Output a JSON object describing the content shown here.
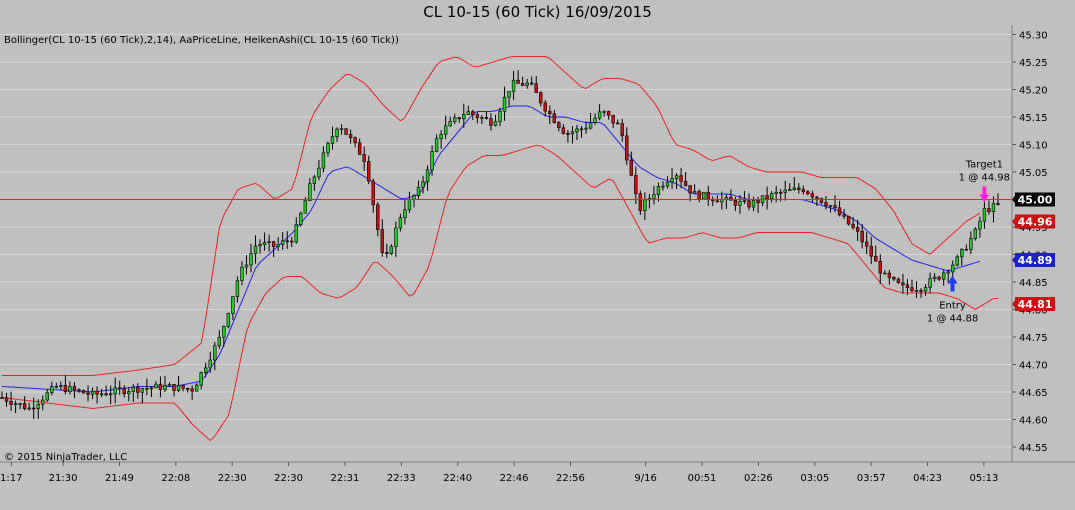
{
  "header": {
    "title": "CL 10-15 (60 Tick)  16/09/2015"
  },
  "indicators_label": "Bollinger(CL 10-15 (60 Tick),2,14), AaPriceLine, HeikenAshi(CL 10-15 (60 Tick))",
  "copyright": "© 2015 NinjaTrader, LLC",
  "colors": {
    "background": "#c0c0c0",
    "grid": "#d6d6d6",
    "up_candle": "#22cc22",
    "down_candle": "#cc1111",
    "bollinger": "#ee2222",
    "middle_band": "#2222ee",
    "price_line": "#ee2222",
    "entry_arrow": "#1f3fff",
    "target_arrow": "#ff22dd"
  },
  "chart_data": {
    "type": "candlestick",
    "ylim": [
      44.53,
      45.31
    ],
    "y_ticks": [
      "45.30",
      "45.25",
      "45.20",
      "45.15",
      "45.10",
      "45.05",
      "45.00",
      "44.95",
      "44.90",
      "44.85",
      "44.80",
      "44.75",
      "44.70",
      "44.65",
      "44.60",
      "44.55"
    ],
    "x_ticks": [
      "1:17",
      "21:30",
      "21:49",
      "22:08",
      "22:30",
      "22:30",
      "22:31",
      "22:33",
      "22:40",
      "22:46",
      "22:56",
      "9/16",
      "00:51",
      "02:26",
      "03:05",
      "03:57",
      "04:23",
      "05:13"
    ],
    "x_tick_positions": [
      2,
      13,
      25,
      37,
      49,
      61,
      73,
      85,
      97,
      109,
      121,
      137,
      149,
      161,
      173,
      185,
      197,
      209
    ],
    "bar_count": 221,
    "price_tags": [
      {
        "name": "current-price",
        "label": "45.00",
        "value": 45.0,
        "bg": "#000000"
      },
      {
        "name": "upper-band",
        "label": "44.96",
        "value": 44.96,
        "bg": "#cc1111"
      },
      {
        "name": "middle-band",
        "label": "44.89",
        "value": 44.89,
        "bg": "#1a22cc"
      },
      {
        "name": "lower-band",
        "label": "44.81",
        "value": 44.81,
        "bg": "#cc1111"
      }
    ],
    "price_line": 45.0,
    "price_path": [
      [
        0,
        44.64
      ],
      [
        6,
        44.62
      ],
      [
        12,
        44.66
      ],
      [
        20,
        44.645
      ],
      [
        28,
        44.655
      ],
      [
        36,
        44.66
      ],
      [
        42,
        44.655
      ],
      [
        48,
        44.75
      ],
      [
        52,
        44.86
      ],
      [
        56,
        44.92
      ],
      [
        60,
        44.915
      ],
      [
        64,
        44.93
      ],
      [
        68,
        45.03
      ],
      [
        74,
        45.14
      ],
      [
        80,
        45.07
      ],
      [
        84,
        44.88
      ],
      [
        88,
        44.98
      ],
      [
        92,
        45.02
      ],
      [
        96,
        45.12
      ],
      [
        102,
        45.16
      ],
      [
        108,
        45.14
      ],
      [
        112,
        45.21
      ],
      [
        116,
        45.21
      ],
      [
        120,
        45.16
      ],
      [
        124,
        45.12
      ],
      [
        128,
        45.13
      ],
      [
        132,
        45.16
      ],
      [
        136,
        45.13
      ],
      [
        140,
        44.98
      ],
      [
        144,
        45.02
      ],
      [
        148,
        45.05
      ],
      [
        152,
        45.01
      ],
      [
        158,
        45.0
      ],
      [
        164,
        44.99
      ],
      [
        170,
        45.01
      ],
      [
        176,
        45.02
      ],
      [
        182,
        44.99
      ],
      [
        188,
        44.94
      ],
      [
        194,
        44.86
      ],
      [
        198,
        44.84
      ],
      [
        202,
        44.84
      ],
      [
        206,
        44.86
      ],
      [
        210,
        44.89
      ],
      [
        214,
        44.94
      ],
      [
        216,
        44.98
      ],
      [
        219,
        44.99
      ]
    ],
    "bollinger_upper": [
      [
        0,
        44.68
      ],
      [
        20,
        44.68
      ],
      [
        30,
        44.69
      ],
      [
        38,
        44.7
      ],
      [
        44,
        44.74
      ],
      [
        48,
        44.96
      ],
      [
        52,
        45.02
      ],
      [
        56,
        45.03
      ],
      [
        60,
        45.0
      ],
      [
        64,
        45.02
      ],
      [
        68,
        45.15
      ],
      [
        72,
        45.2
      ],
      [
        76,
        45.23
      ],
      [
        80,
        45.21
      ],
      [
        84,
        45.17
      ],
      [
        88,
        45.14
      ],
      [
        92,
        45.2
      ],
      [
        96,
        45.25
      ],
      [
        100,
        45.26
      ],
      [
        104,
        45.24
      ],
      [
        108,
        45.25
      ],
      [
        112,
        45.26
      ],
      [
        116,
        45.26
      ],
      [
        120,
        45.26
      ],
      [
        124,
        45.23
      ],
      [
        128,
        45.2
      ],
      [
        132,
        45.22
      ],
      [
        136,
        45.22
      ],
      [
        140,
        45.21
      ],
      [
        144,
        45.17
      ],
      [
        148,
        45.1
      ],
      [
        152,
        45.09
      ],
      [
        156,
        45.07
      ],
      [
        160,
        45.08
      ],
      [
        164,
        45.06
      ],
      [
        168,
        45.05
      ],
      [
        172,
        45.05
      ],
      [
        176,
        45.05
      ],
      [
        180,
        45.04
      ],
      [
        184,
        45.04
      ],
      [
        188,
        45.04
      ],
      [
        192,
        45.02
      ],
      [
        196,
        44.98
      ],
      [
        200,
        44.92
      ],
      [
        204,
        44.9
      ],
      [
        208,
        44.93
      ],
      [
        212,
        44.96
      ],
      [
        216,
        44.98
      ]
    ],
    "bollinger_lower": [
      [
        0,
        44.64
      ],
      [
        20,
        44.62
      ],
      [
        30,
        44.63
      ],
      [
        38,
        44.63
      ],
      [
        42,
        44.59
      ],
      [
        46,
        44.56
      ],
      [
        50,
        44.61
      ],
      [
        54,
        44.77
      ],
      [
        58,
        44.83
      ],
      [
        62,
        44.86
      ],
      [
        66,
        44.86
      ],
      [
        70,
        44.83
      ],
      [
        74,
        44.82
      ],
      [
        78,
        44.84
      ],
      [
        82,
        44.89
      ],
      [
        86,
        44.86
      ],
      [
        90,
        44.82
      ],
      [
        94,
        44.88
      ],
      [
        98,
        45.01
      ],
      [
        102,
        45.06
      ],
      [
        106,
        45.08
      ],
      [
        110,
        45.08
      ],
      [
        114,
        45.09
      ],
      [
        118,
        45.1
      ],
      [
        122,
        45.08
      ],
      [
        126,
        45.05
      ],
      [
        130,
        45.02
      ],
      [
        134,
        45.04
      ],
      [
        138,
        44.98
      ],
      [
        142,
        44.92
      ],
      [
        146,
        44.93
      ],
      [
        150,
        44.93
      ],
      [
        154,
        44.94
      ],
      [
        158,
        44.93
      ],
      [
        162,
        44.93
      ],
      [
        166,
        44.94
      ],
      [
        170,
        44.94
      ],
      [
        174,
        44.94
      ],
      [
        178,
        44.94
      ],
      [
        182,
        44.93
      ],
      [
        186,
        44.92
      ],
      [
        190,
        44.88
      ],
      [
        194,
        44.84
      ],
      [
        198,
        44.83
      ],
      [
        202,
        44.83
      ],
      [
        206,
        44.83
      ],
      [
        210,
        44.82
      ],
      [
        214,
        44.8
      ],
      [
        218,
        44.82
      ]
    ],
    "bollinger_middle": [
      [
        0,
        44.66
      ],
      [
        20,
        44.65
      ],
      [
        30,
        44.66
      ],
      [
        38,
        44.66
      ],
      [
        44,
        44.67
      ],
      [
        48,
        44.72
      ],
      [
        52,
        44.8
      ],
      [
        56,
        44.88
      ],
      [
        60,
        44.91
      ],
      [
        64,
        44.94
      ],
      [
        68,
        44.98
      ],
      [
        72,
        45.05
      ],
      [
        76,
        45.06
      ],
      [
        80,
        45.04
      ],
      [
        84,
        45.02
      ],
      [
        88,
        45.0
      ],
      [
        92,
        45.01
      ],
      [
        96,
        45.08
      ],
      [
        100,
        45.12
      ],
      [
        104,
        45.16
      ],
      [
        108,
        45.16
      ],
      [
        112,
        45.17
      ],
      [
        116,
        45.17
      ],
      [
        120,
        45.15
      ],
      [
        124,
        45.15
      ],
      [
        128,
        45.14
      ],
      [
        132,
        45.14
      ],
      [
        136,
        45.1
      ],
      [
        140,
        45.06
      ],
      [
        144,
        45.04
      ],
      [
        148,
        45.03
      ],
      [
        152,
        45.01
      ],
      [
        156,
        45.01
      ],
      [
        160,
        45.01
      ],
      [
        164,
        45.0
      ],
      [
        168,
        45.0
      ],
      [
        172,
        45.0
      ],
      [
        176,
        45.0
      ],
      [
        180,
        44.99
      ],
      [
        184,
        44.98
      ],
      [
        188,
        44.96
      ],
      [
        192,
        44.93
      ],
      [
        196,
        44.91
      ],
      [
        200,
        44.89
      ],
      [
        204,
        44.88
      ],
      [
        208,
        44.87
      ],
      [
        212,
        44.88
      ],
      [
        216,
        44.89
      ]
    ],
    "annotations": [
      {
        "name": "entry",
        "text_top": "Entry",
        "text_bottom": "1 @ 44.88",
        "bar": 209,
        "price": 44.88
      },
      {
        "name": "target",
        "text_top": "Target1",
        "text_bottom": "1 @ 44.98",
        "bar": 216,
        "price": 44.98
      }
    ]
  }
}
